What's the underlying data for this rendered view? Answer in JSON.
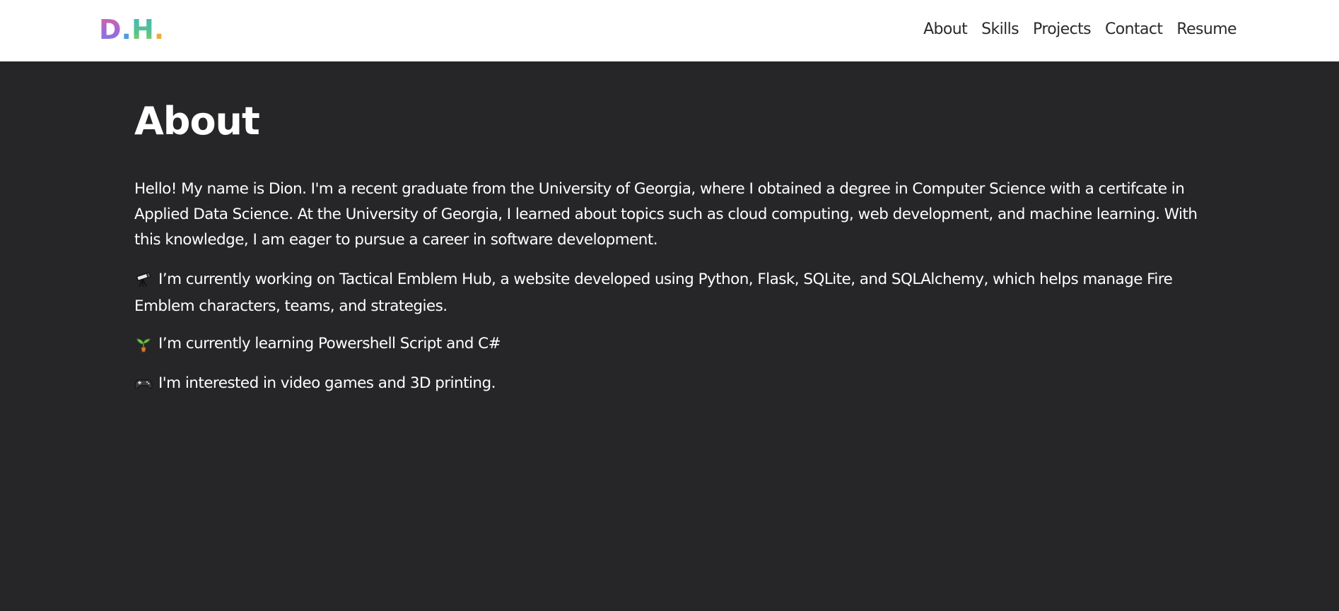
{
  "header": {
    "logo": {
      "letters": [
        "D",
        ".",
        "H",
        "."
      ]
    },
    "nav": [
      {
        "label": "About"
      },
      {
        "label": "Skills"
      },
      {
        "label": "Projects"
      },
      {
        "label": "Contact"
      },
      {
        "label": "Resume"
      }
    ]
  },
  "about": {
    "title": "About",
    "intro": "Hello! My name is Dion. I'm a recent graduate from the University of Georgia, where I obtained a degree in Computer Science with a certifcate in Applied Data Science. At the University of Georgia, I learned about topics such as cloud computing, web development, and machine learning. With this knowledge, I am eager to pursue a career in software development.",
    "items": [
      {
        "icon": "telescope-icon",
        "text": "I’m currently working on Tactical Emblem Hub, a website developed using Python, Flask, SQLite, and SQLAlchemy, which helps manage Fire Emblem characters, teams, and strategies."
      },
      {
        "icon": "seedling-icon",
        "text": "I’m currently learning Powershell Script and C#"
      },
      {
        "icon": "game-controller-icon",
        "text": "I'm interested in video games and 3D printing."
      }
    ]
  },
  "colors": {
    "background": "#262628",
    "navbar": "#ffffff",
    "text": "#ffffff",
    "logo_d": "#9b6ad6",
    "logo_dot1": "#4a9fd8",
    "logo_h": "#58c28a",
    "logo_dot2": "#f2a93b"
  }
}
